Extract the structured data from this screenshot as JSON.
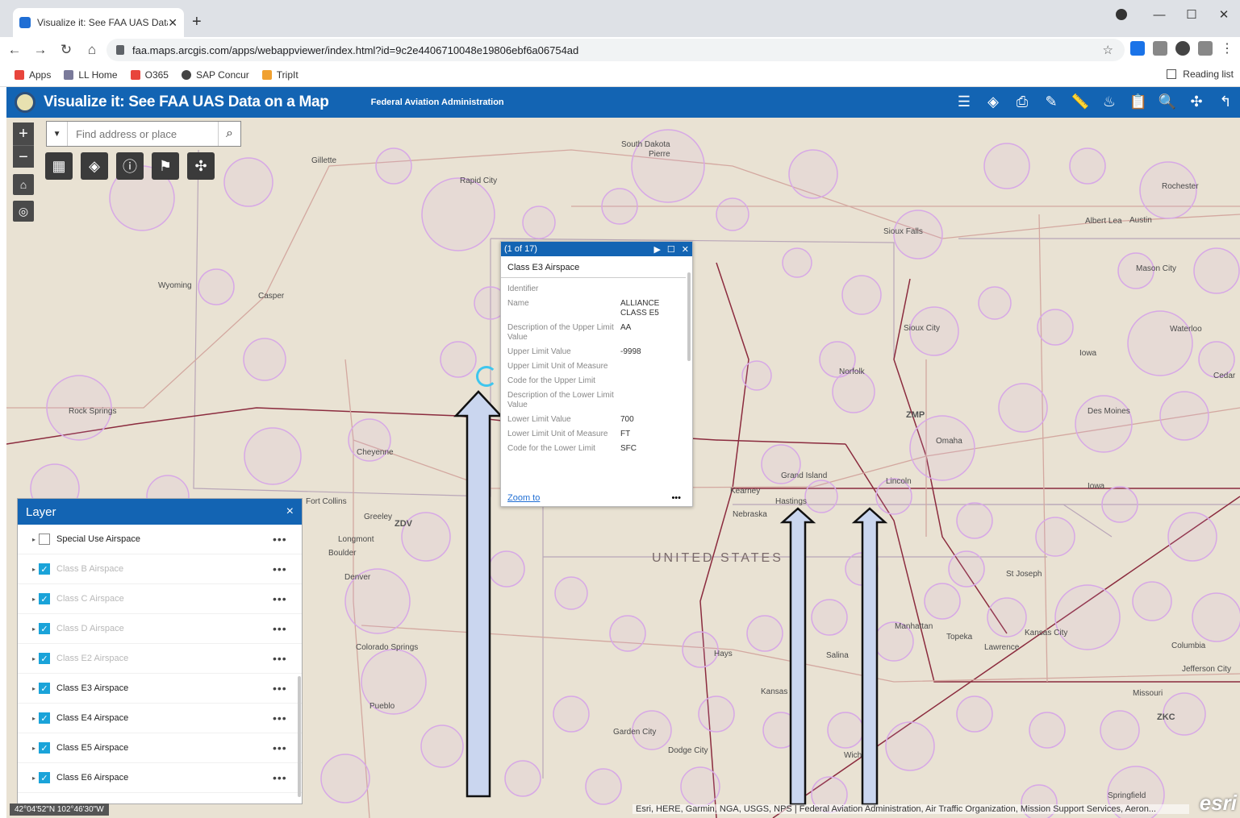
{
  "browser": {
    "tab_title": "Visualize it: See FAA UAS Data on a Map",
    "url": "faa.maps.arcgis.com/apps/webappviewer/index.html?id=9c2e4406710048e19806ebf6a06754ad",
    "bookmarks": [
      {
        "label": "Apps",
        "color": "#e8453c"
      },
      {
        "label": "LL Home",
        "color": "#7a7a9a"
      },
      {
        "label": "O365",
        "color": "#e8453c"
      },
      {
        "label": "SAP Concur",
        "color": "#444444"
      },
      {
        "label": "TripIt",
        "color": "#f0a030"
      }
    ],
    "reading_list": "Reading list"
  },
  "app": {
    "title": "Visualize it: See FAA UAS Data on a Map",
    "subtitle": "Federal Aviation Administration",
    "header_color": "#1364b3"
  },
  "search": {
    "placeholder": "Find address or place"
  },
  "popup": {
    "counter": "(1 of 17)",
    "title": "Class E3 Airspace",
    "fields": [
      {
        "key": "Identifier",
        "value": ""
      },
      {
        "key": "Name",
        "value": "ALLIANCE CLASS E5"
      },
      {
        "key": "Description of the Upper Limit Value",
        "value": "AA"
      },
      {
        "key": "Upper Limit Value",
        "value": "-9998"
      },
      {
        "key": "Upper Limit Unit of Measure",
        "value": ""
      },
      {
        "key": "Code for the Upper Limit",
        "value": ""
      },
      {
        "key": "Description of the Lower Limit Value",
        "value": ""
      },
      {
        "key": "Lower Limit Value",
        "value": "700"
      },
      {
        "key": "Lower Limit Unit of Measure",
        "value": "FT"
      },
      {
        "key": "Code for the Lower Limit",
        "value": "SFC"
      }
    ],
    "zoom_label": "Zoom to",
    "more_label": "•••"
  },
  "layer_panel": {
    "title": "Layer",
    "close": "×",
    "layers": [
      {
        "name": "Special Use Airspace",
        "checked": false,
        "dim": false
      },
      {
        "name": "Class B Airspace",
        "checked": true,
        "dim": true
      },
      {
        "name": "Class C Airspace",
        "checked": true,
        "dim": true
      },
      {
        "name": "Class D Airspace",
        "checked": true,
        "dim": true
      },
      {
        "name": "Class E2 Airspace",
        "checked": true,
        "dim": true
      },
      {
        "name": "Class E3 Airspace",
        "checked": true,
        "dim": false
      },
      {
        "name": "Class E4 Airspace",
        "checked": true,
        "dim": false
      },
      {
        "name": "Class E5 Airspace",
        "checked": true,
        "dim": false
      },
      {
        "name": "Class E6 Airspace",
        "checked": true,
        "dim": false
      }
    ]
  },
  "map_labels": [
    {
      "text": "South Dakota",
      "cls": ""
    },
    {
      "text": "Pierre",
      "cls": ""
    },
    {
      "text": "Gillette",
      "cls": ""
    },
    {
      "text": "Rapid City",
      "cls": ""
    },
    {
      "text": "Rochester",
      "cls": ""
    },
    {
      "text": "Albert Lea",
      "cls": ""
    },
    {
      "text": "Austin",
      "cls": ""
    },
    {
      "text": "Sioux Falls",
      "cls": ""
    },
    {
      "text": "Mason City",
      "cls": ""
    },
    {
      "text": "Wyoming",
      "cls": ""
    },
    {
      "text": "Casper",
      "cls": ""
    },
    {
      "text": "Sioux City",
      "cls": ""
    },
    {
      "text": "Waterloo",
      "cls": ""
    },
    {
      "text": "Iowa",
      "cls": ""
    },
    {
      "text": "Norfolk",
      "cls": ""
    },
    {
      "text": "Cedar",
      "cls": ""
    },
    {
      "text": "Rock Springs",
      "cls": ""
    },
    {
      "text": "ZMP",
      "cls": "reg"
    },
    {
      "text": "Des Moines",
      "cls": ""
    },
    {
      "text": "Omaha",
      "cls": ""
    },
    {
      "text": "Cheyenne",
      "cls": ""
    },
    {
      "text": "Grand Island",
      "cls": ""
    },
    {
      "text": "Lincoln",
      "cls": ""
    },
    {
      "text": "Kearney",
      "cls": ""
    },
    {
      "text": "Iowa",
      "cls": ""
    },
    {
      "text": "Fort Collins",
      "cls": ""
    },
    {
      "text": "Hastings",
      "cls": ""
    },
    {
      "text": "Greeley",
      "cls": ""
    },
    {
      "text": "ZDV",
      "cls": "reg"
    },
    {
      "text": "Nebraska",
      "cls": ""
    },
    {
      "text": "Longmont",
      "cls": ""
    },
    {
      "text": "Boulder",
      "cls": ""
    },
    {
      "text": "UNITED STATES",
      "cls": "big"
    },
    {
      "text": "Denver",
      "cls": ""
    },
    {
      "text": "St Joseph",
      "cls": ""
    },
    {
      "text": "Manhattan",
      "cls": ""
    },
    {
      "text": "Topeka",
      "cls": ""
    },
    {
      "text": "Kansas City",
      "cls": ""
    },
    {
      "text": "Lawrence",
      "cls": ""
    },
    {
      "text": "Columbia",
      "cls": ""
    },
    {
      "text": "Colorado Springs",
      "cls": ""
    },
    {
      "text": "Hays",
      "cls": ""
    },
    {
      "text": "Salina",
      "cls": ""
    },
    {
      "text": "Jefferson City",
      "cls": ""
    },
    {
      "text": "Kansas",
      "cls": ""
    },
    {
      "text": "Missouri",
      "cls": ""
    },
    {
      "text": "Pueblo",
      "cls": ""
    },
    {
      "text": "ZKC",
      "cls": "reg"
    },
    {
      "text": "Garden City",
      "cls": ""
    },
    {
      "text": "Dodge City",
      "cls": ""
    },
    {
      "text": "Wich",
      "cls": ""
    },
    {
      "text": "Springfield",
      "cls": ""
    }
  ],
  "footer": {
    "coords": "42°04'52\"N 102°46'30\"W",
    "attribution": "Esri, HERE, Garmin, NGA, USGS, NPS | Federal Aviation Administration, Air Traffic Organization, Mission Support Services, Aeron...",
    "esri": "esri"
  }
}
